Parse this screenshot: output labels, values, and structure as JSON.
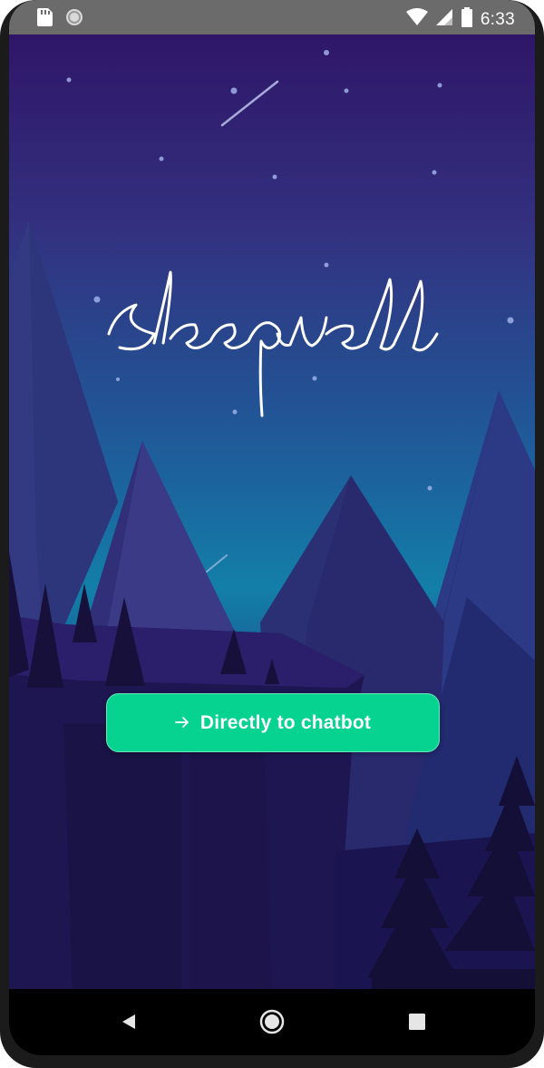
{
  "status_bar": {
    "time": "6:33",
    "left_icons": [
      "sd-card-icon",
      "sync-circle-icon"
    ],
    "right_icons": [
      "wifi-icon",
      "cell-signal-icon",
      "battery-icon"
    ]
  },
  "app": {
    "logo_text": "sleepwell",
    "cta": {
      "label": "Directly to chatbot",
      "icon": "arrow-right-icon"
    }
  },
  "nav_bar": {
    "buttons": [
      "back-icon",
      "home-icon",
      "recents-icon"
    ]
  },
  "colors": {
    "accent": "#05d38f",
    "sky_top": "#2f1668",
    "sky_mid": "#137fa8",
    "status_bar": "#6b6b6b"
  }
}
